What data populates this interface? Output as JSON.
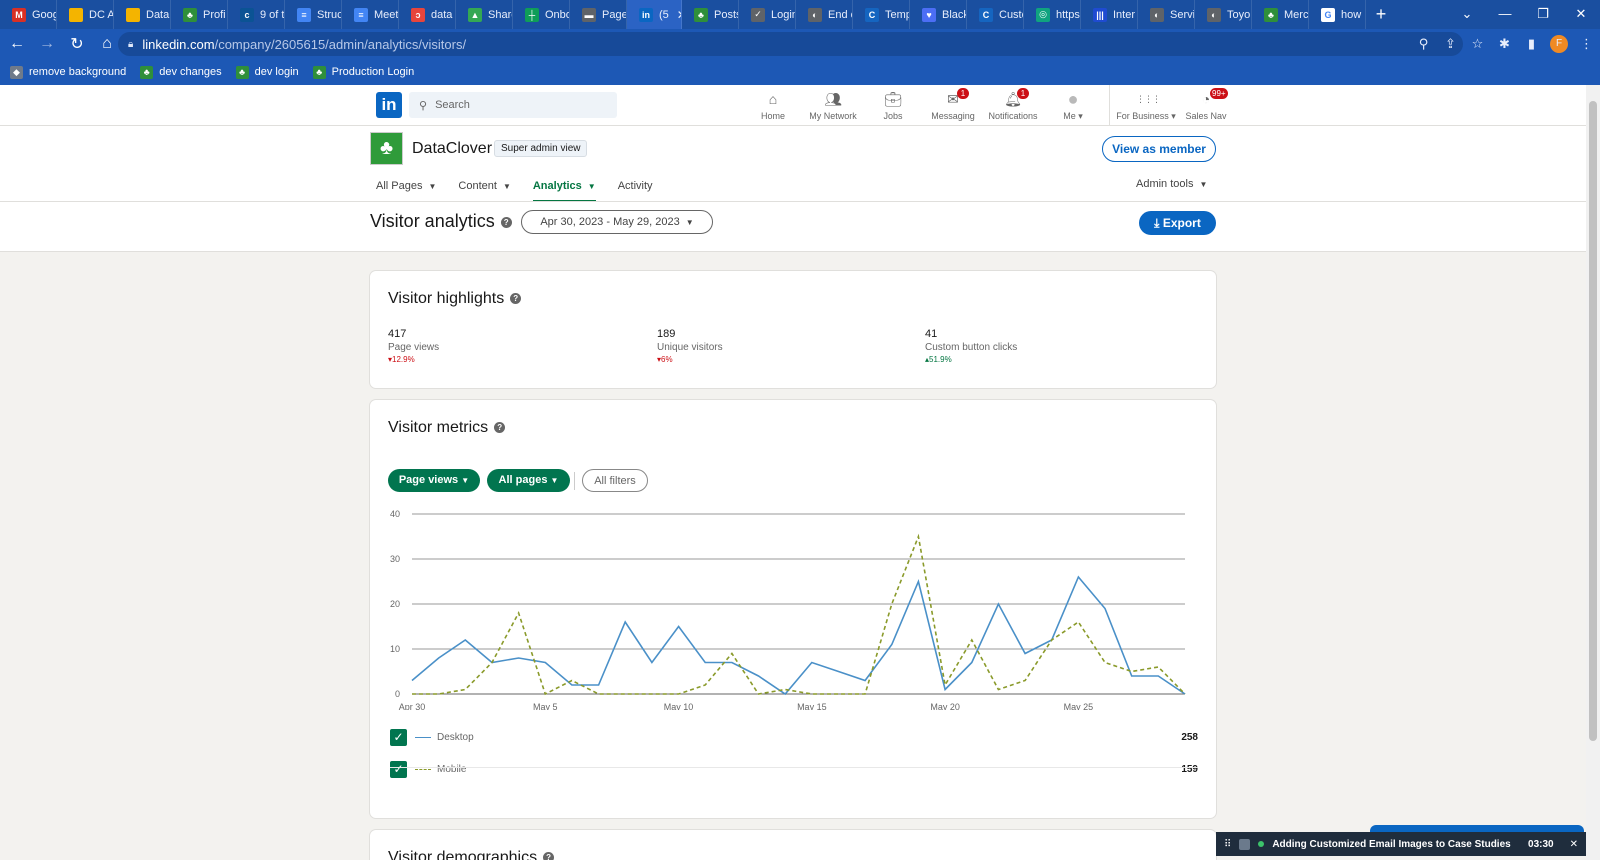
{
  "browser": {
    "tabs": [
      {
        "label": "Goog",
        "icon": "gmail-icon",
        "color": "#d93025",
        "glyph": "M"
      },
      {
        "label": "DC A",
        "icon": "slides-icon",
        "color": "#f4b400",
        "glyph": ""
      },
      {
        "label": "Data",
        "icon": "slides-icon",
        "color": "#f4b400",
        "glyph": ""
      },
      {
        "label": "Profi",
        "icon": "clover-icon",
        "color": "#2f8f3a",
        "glyph": "♣"
      },
      {
        "label": "9 of t",
        "icon": "cbt-icon",
        "color": "#0b5394",
        "glyph": "c"
      },
      {
        "label": "Struc",
        "icon": "docs-icon",
        "color": "#4285f4",
        "glyph": "≡"
      },
      {
        "label": "Meet",
        "icon": "docs-icon",
        "color": "#4285f4",
        "glyph": "≡"
      },
      {
        "label": "data",
        "icon": "red-swirl-icon",
        "color": "#e8453c",
        "glyph": "ↄ"
      },
      {
        "label": "Share",
        "icon": "drive-icon",
        "color": "#34a853",
        "glyph": "▲"
      },
      {
        "label": "Onbo",
        "icon": "sheets-icon",
        "color": "#0f9d58",
        "glyph": "┼"
      },
      {
        "label": "Page",
        "icon": "car-icon",
        "color": "#5f6368",
        "glyph": "▬"
      },
      {
        "label": "(5",
        "icon": "linkedin-icon",
        "color": "#0a66c2",
        "glyph": "in",
        "active": true
      },
      {
        "label": "Posts",
        "icon": "clover-icon",
        "color": "#2f8f3a",
        "glyph": "♣"
      },
      {
        "label": "Login",
        "icon": "check-icon",
        "color": "#5f6368",
        "glyph": "✓"
      },
      {
        "label": "End c",
        "icon": "globe-icon",
        "color": "#5f6368",
        "glyph": "◐"
      },
      {
        "label": "Temp",
        "icon": "c-icon",
        "color": "#1565c0",
        "glyph": "C"
      },
      {
        "label": "Black",
        "icon": "shield-icon",
        "color": "#4c6ef5",
        "glyph": "♥"
      },
      {
        "label": "Custo",
        "icon": "c-icon",
        "color": "#1565c0",
        "glyph": "C"
      },
      {
        "label": "https",
        "icon": "chatgpt-icon",
        "color": "#10a37f",
        "glyph": "◎"
      },
      {
        "label": "Inter",
        "icon": "intercom-icon",
        "color": "#1f4bd1",
        "glyph": "|||"
      },
      {
        "label": "Servi",
        "icon": "globe-icon",
        "color": "#5f6368",
        "glyph": "◐"
      },
      {
        "label": "Toyo",
        "icon": "globe-icon",
        "color": "#5f6368",
        "glyph": "◐"
      },
      {
        "label": "Merc",
        "icon": "clover-icon",
        "color": "#2f8f3a",
        "glyph": "♣"
      },
      {
        "label": "how",
        "icon": "google-icon",
        "color": "#ffffff",
        "glyph": "G"
      }
    ],
    "url_host": "linkedin.com",
    "url_path": "/company/2605615/admin/analytics/visitors/",
    "profile_initial": "F",
    "bookmarks": [
      {
        "label": "remove background",
        "icon": "remove-bg-icon"
      },
      {
        "label": "dev changes",
        "icon": "clover-icon"
      },
      {
        "label": "dev login",
        "icon": "clover-icon"
      },
      {
        "label": "Production Login",
        "icon": "clover-icon"
      }
    ]
  },
  "linkedin": {
    "search_placeholder": "Search",
    "nav": [
      {
        "label": "Home",
        "icon": "home-icon",
        "badge": ""
      },
      {
        "label": "My Network",
        "icon": "network-icon",
        "badge": ""
      },
      {
        "label": "Jobs",
        "icon": "briefcase-icon",
        "badge": ""
      },
      {
        "label": "Messaging",
        "icon": "messaging-icon",
        "badge": "1"
      },
      {
        "label": "Notifications",
        "icon": "bell-icon",
        "badge": "1"
      },
      {
        "label": "Me ▾",
        "icon": "avatar-icon",
        "badge": ""
      }
    ],
    "nav_right": [
      {
        "label": "For Business ▾",
        "icon": "grid-icon",
        "badge": ""
      },
      {
        "label": "Sales Nav",
        "icon": "compass-icon",
        "badge": "99+"
      }
    ]
  },
  "page": {
    "org_name": "DataClover",
    "admin_badge": "Super admin view",
    "view_as_member": "View as member",
    "subnav": [
      {
        "label": "All Pages",
        "active": false
      },
      {
        "label": "Content",
        "active": false
      },
      {
        "label": "Analytics",
        "active": true
      },
      {
        "label": "Activity",
        "active": false
      }
    ],
    "admin_tools": "Admin tools",
    "title": "Visitor analytics",
    "date_range": "Apr 30, 2023 - May 29, 2023",
    "export_label": "Export"
  },
  "highlights": {
    "title": "Visitor highlights",
    "items": [
      {
        "value": "417",
        "label": "Page views",
        "change": "▾12.9%",
        "direction": "down"
      },
      {
        "value": "189",
        "label": "Unique visitors",
        "change": "▾6%",
        "direction": "down"
      },
      {
        "value": "41",
        "label": "Custom button clicks",
        "change": "▴51.9%",
        "direction": "up"
      }
    ]
  },
  "metrics": {
    "title": "Visitor metrics",
    "filter_metric": "Page views",
    "filter_pages": "All pages",
    "all_filters": "All filters",
    "legend": [
      {
        "name": "Desktop",
        "total": "258",
        "color": "#4a90c8",
        "style": "solid"
      },
      {
        "name": "Mobile",
        "total": "159",
        "color": "#8a9a2a",
        "style": "dashed"
      }
    ]
  },
  "next_section_title": "Visitor demographics",
  "recorder": {
    "title": "Adding Customized Email Images to Case Studies",
    "time": "03:30"
  },
  "chart_data": {
    "type": "line",
    "x_ticks": [
      "Apr 30",
      "May 5",
      "May 10",
      "May 15",
      "May 20",
      "May 25"
    ],
    "y_ticks": [
      0,
      10,
      20,
      30,
      40
    ],
    "ylim": [
      0,
      40
    ],
    "x": [
      "Apr 30",
      "May 1",
      "May 2",
      "May 3",
      "May 4",
      "May 5",
      "May 6",
      "May 7",
      "May 8",
      "May 9",
      "May 10",
      "May 11",
      "May 12",
      "May 13",
      "May 14",
      "May 15",
      "May 16",
      "May 17",
      "May 18",
      "May 19",
      "May 20",
      "May 21",
      "May 22",
      "May 23",
      "May 24",
      "May 25",
      "May 26",
      "May 27",
      "May 28",
      "May 29"
    ],
    "series": [
      {
        "name": "Desktop",
        "values": [
          3,
          8,
          12,
          7,
          8,
          7,
          2,
          2,
          16,
          7,
          15,
          7,
          7,
          4,
          0,
          7,
          5,
          3,
          11,
          25,
          1,
          7,
          20,
          9,
          12,
          26,
          19,
          4,
          4,
          0
        ]
      },
      {
        "name": "Mobile",
        "values": [
          0,
          0,
          1,
          7,
          18,
          0,
          3,
          0,
          0,
          0,
          0,
          2,
          9,
          0,
          1,
          0,
          0,
          0,
          20,
          35,
          2,
          12,
          1,
          3,
          12,
          16,
          7,
          5,
          6,
          0
        ]
      }
    ]
  }
}
